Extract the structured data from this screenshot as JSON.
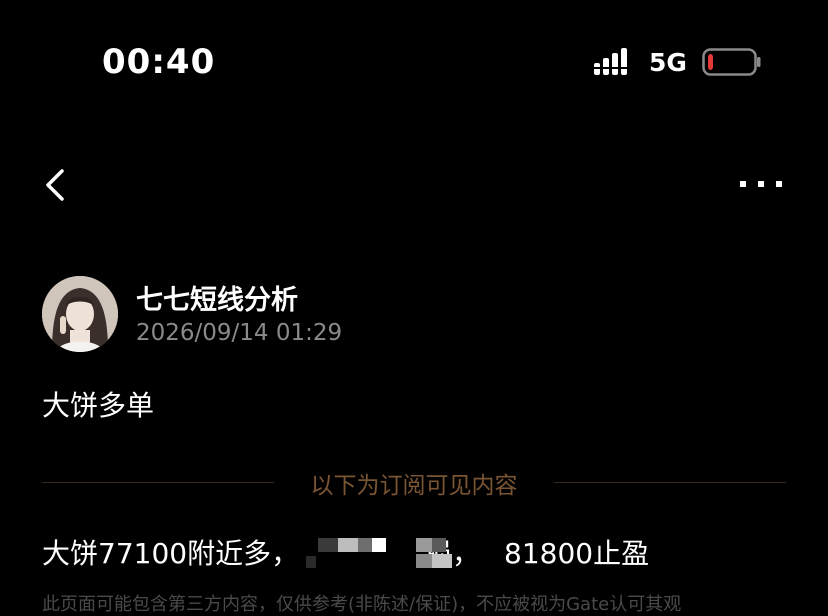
{
  "status_bar": {
    "time": "00:40",
    "network": "5G",
    "battery_level": 0.12,
    "battery_color": "#e53935",
    "icons": [
      "signal-icon",
      "battery-icon"
    ]
  },
  "nav": {
    "icons": [
      "back-chevron-icon",
      "more-dots-icon"
    ]
  },
  "author": {
    "name": "七七短线分析",
    "timestamp": "2026/09/14 01:29"
  },
  "post": {
    "title": "大饼多单",
    "divider_label": "以下为订阅可见内容",
    "content_prefix": "大饼77100附近多，",
    "content_partial": "损，",
    "content_suffix": "81800止盈",
    "footer_note": "此页面可能包含第三方内容，仅供参考(非陈述/保证)，不应被视为Gate认可其观"
  },
  "colors": {
    "background": "#000000",
    "accent_divider": "#7a5534",
    "muted_text": "#8a8a8a"
  }
}
